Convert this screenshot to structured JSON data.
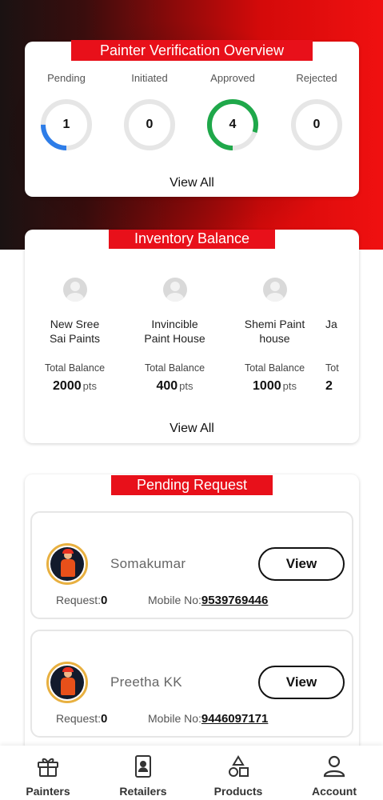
{
  "verification": {
    "title": "Painter Verification Overview",
    "stats": [
      {
        "label": "Pending",
        "value": "1",
        "progress": 0.25,
        "color": "#2e7de8"
      },
      {
        "label": "Initiated",
        "value": "0",
        "progress": 0,
        "color": "#2e7de8"
      },
      {
        "label": "Approved",
        "value": "4",
        "progress": 0.8,
        "color": "#1fa84a"
      },
      {
        "label": "Rejected",
        "value": "0",
        "progress": 0,
        "color": "#2e7de8"
      }
    ],
    "view_all": "View All"
  },
  "inventory": {
    "title": "Inventory Balance",
    "stores": [
      {
        "name": "New Sree\nSai Paints",
        "balance_label": "Total Balance",
        "balance": "2000",
        "unit": "pts"
      },
      {
        "name": "Invincible\nPaint House",
        "balance_label": "Total Balance",
        "balance": "400",
        "unit": "pts"
      },
      {
        "name": "Shemi Paint\nhouse",
        "balance_label": "Total Balance",
        "balance": "1000",
        "unit": "pts"
      },
      {
        "name": "Ja",
        "balance_label": "Tot",
        "balance": "2",
        "unit": ""
      }
    ],
    "view_all": "View All"
  },
  "pending": {
    "title": "Pending Request",
    "requests": [
      {
        "name": "Somakumar",
        "button": "View",
        "request_label": "Request:",
        "request_value": "0",
        "mobile_label": "Mobile No:",
        "mobile": "9539769446"
      },
      {
        "name": "Preetha KK",
        "button": "View",
        "request_label": "Request:",
        "request_value": "0",
        "mobile_label": "Mobile No:",
        "mobile": "9446097171"
      }
    ]
  },
  "nav": {
    "items": [
      {
        "label": "Painters",
        "icon": "gift-icon"
      },
      {
        "label": "Retailers",
        "icon": "id-card-icon"
      },
      {
        "label": "Products",
        "icon": "shapes-icon"
      },
      {
        "label": "Account",
        "icon": "user-icon"
      }
    ]
  },
  "colors": {
    "accent": "#e8101a",
    "approved": "#1fa84a",
    "pending": "#2e7de8",
    "ring_track": "#e6e6e6"
  }
}
